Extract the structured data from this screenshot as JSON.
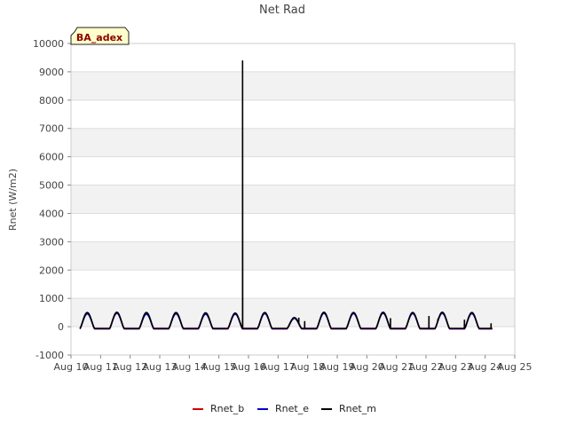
{
  "chart_data": {
    "type": "line",
    "title": "Net Rad",
    "ylabel": "Rnet (W/m2)",
    "xlabel": "",
    "site_label": "BA_adex",
    "ylim": [
      -1000,
      10000
    ],
    "xlim": [
      10,
      25
    ],
    "yticks": [
      -1000,
      0,
      1000,
      2000,
      3000,
      4000,
      5000,
      6000,
      7000,
      8000,
      9000,
      10000
    ],
    "xticks": [
      10,
      11,
      12,
      13,
      14,
      15,
      16,
      17,
      18,
      19,
      20,
      21,
      22,
      23,
      24,
      25
    ],
    "xtick_labels": [
      "Aug 10",
      "Aug 11",
      "Aug 12",
      "Aug 13",
      "Aug 14",
      "Aug 15",
      "Aug 16",
      "Aug 17",
      "Aug 18",
      "Aug 19",
      "Aug 20",
      "Aug 21",
      "Aug 22",
      "Aug 23",
      "Aug 24",
      "Aug 25"
    ],
    "grid": true,
    "banded_background": true,
    "legend_position": "bottom-center",
    "series_period_days": 1,
    "series_start": 10.3,
    "series_end": 24.25,
    "series": [
      {
        "name": "Rnet_b",
        "color": "#cc0000",
        "daily_peak": [
          480,
          490,
          470,
          480,
          470,
          460,
          480,
          300,
          490,
          480,
          490,
          480,
          490,
          480
        ],
        "night_value": -80
      },
      {
        "name": "Rnet_e",
        "color": "#0000cc",
        "daily_peak": [
          450,
          470,
          440,
          450,
          440,
          440,
          460,
          290,
          470,
          460,
          470,
          460,
          470,
          460
        ],
        "night_value": -70
      },
      {
        "name": "Rnet_m",
        "color": "#000000",
        "daily_peak": [
          500,
          510,
          500,
          500,
          490,
          480,
          500,
          320,
          510,
          500,
          510,
          500,
          510,
          500
        ],
        "night_value": -60,
        "spikes": [
          {
            "x": 15.8,
            "y": 9400
          },
          {
            "x": 17.7,
            "y": 320
          },
          {
            "x": 17.9,
            "y": 200
          },
          {
            "x": 20.8,
            "y": 300
          },
          {
            "x": 22.1,
            "y": 380
          },
          {
            "x": 22.4,
            "y": 200
          },
          {
            "x": 23.3,
            "y": 250
          },
          {
            "x": 24.2,
            "y": 120
          }
        ]
      }
    ]
  }
}
